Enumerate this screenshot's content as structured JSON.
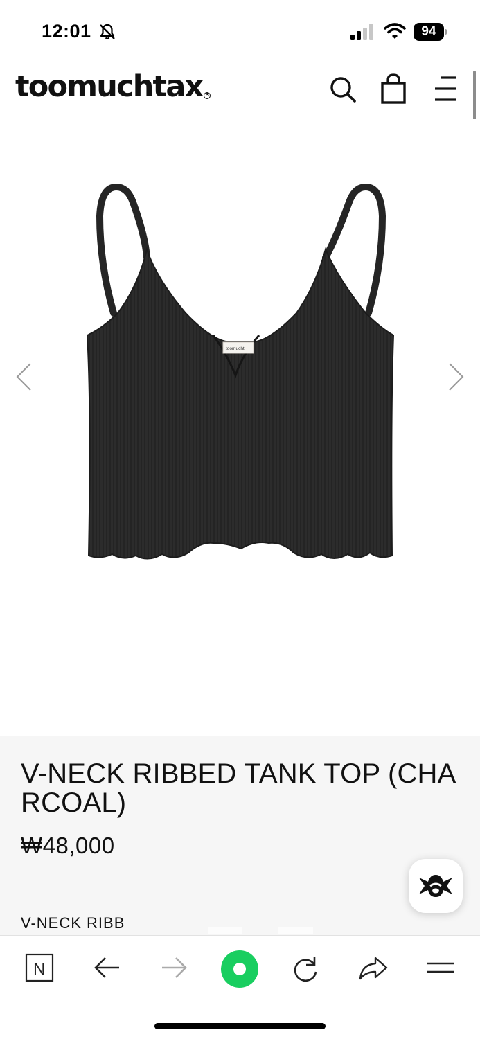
{
  "status_bar": {
    "time": "12:01",
    "battery": "94"
  },
  "header": {
    "logo": "toomuchtax",
    "logo_mark": "S"
  },
  "product": {
    "image_tag_text": "toomucht",
    "title": "V-NECK RIBBED TANK TOP (CHARCOAL)",
    "price": "₩48,000",
    "description_preview": "V-NECK RIBB",
    "color": "#2b2b2b"
  },
  "toolbar": {
    "naver_label": "N"
  },
  "colors": {
    "accent_green": "#19ce60",
    "info_bg": "#f6f6f6"
  }
}
